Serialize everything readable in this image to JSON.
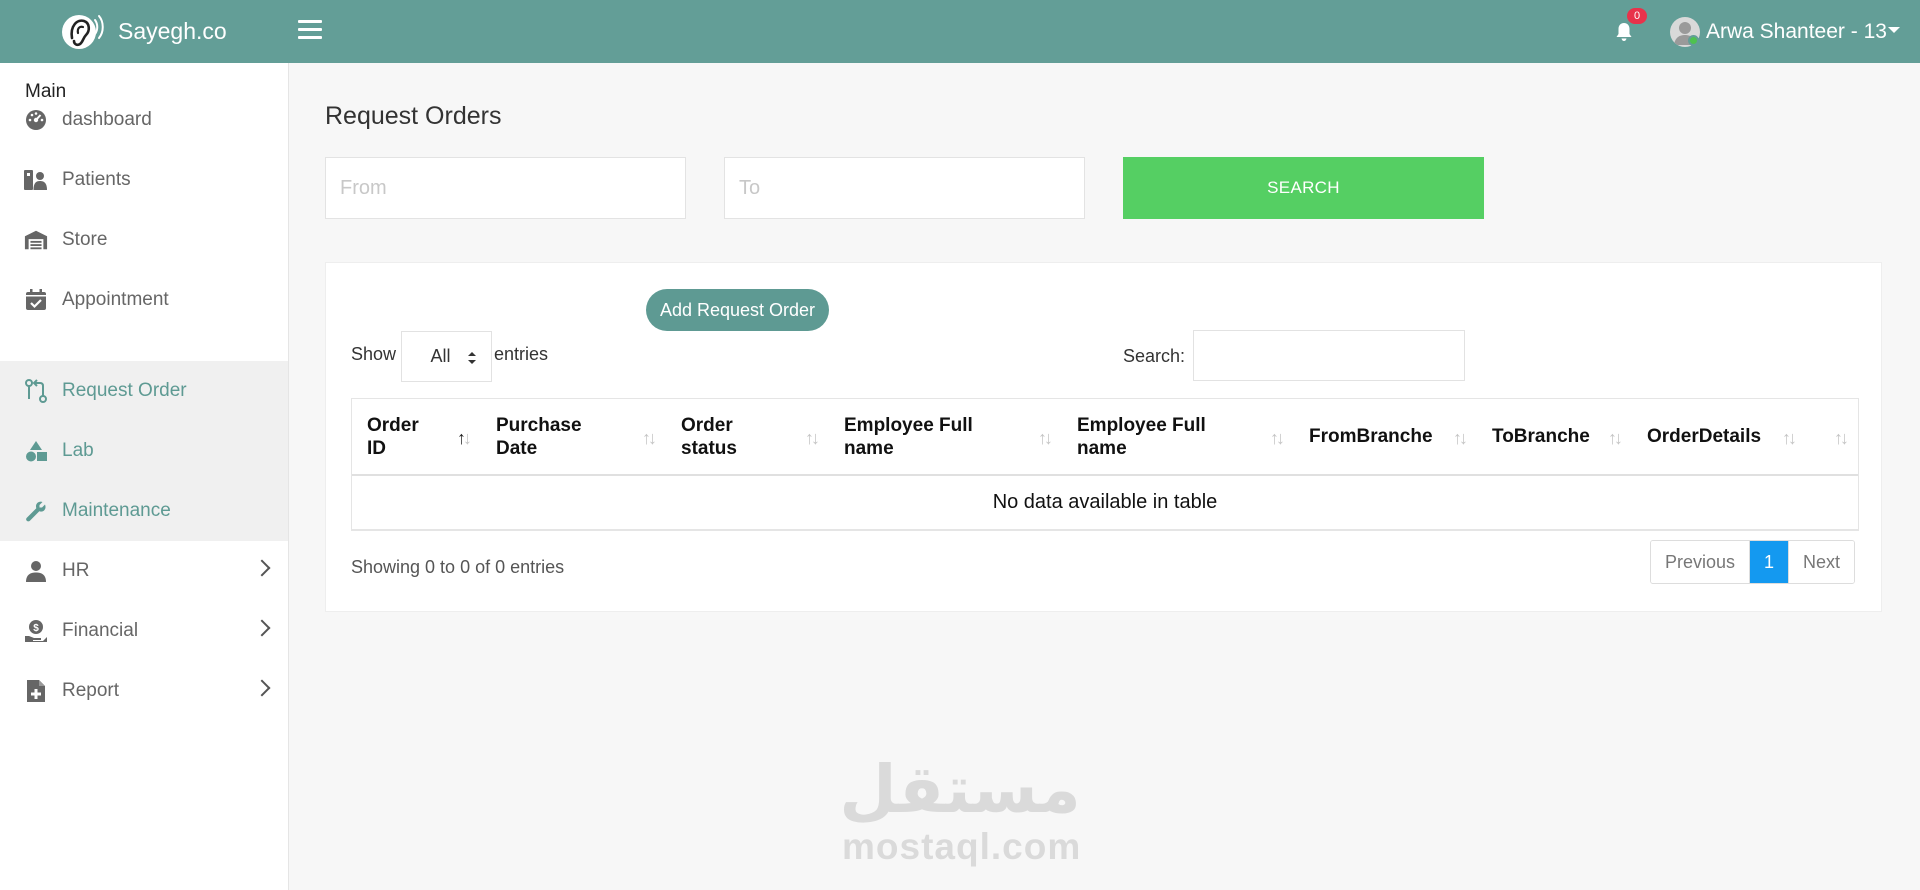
{
  "header": {
    "brand": "Sayegh.co",
    "notification_count": "0",
    "user_name": "Arwa Shanteer - 13",
    "bar_color": "#639e97"
  },
  "sidebar": {
    "heading": "Main",
    "items": [
      {
        "label": "dashboard",
        "icon": "dashboard-icon",
        "active": false,
        "has_submenu": false
      },
      {
        "label": "Patients",
        "icon": "patients-icon",
        "active": false,
        "has_submenu": false
      },
      {
        "label": "Store",
        "icon": "warehouse-icon",
        "active": false,
        "has_submenu": false
      },
      {
        "label": "Appointment",
        "icon": "calendar-check-icon",
        "active": false,
        "has_submenu": false
      },
      {
        "label": "Request Order",
        "icon": "route-icon",
        "active": true,
        "has_submenu": false
      },
      {
        "label": "Lab",
        "icon": "shapes-icon",
        "active": true,
        "has_submenu": false
      },
      {
        "label": "Maintenance",
        "icon": "wrench-icon",
        "active": true,
        "has_submenu": false
      },
      {
        "label": "HR",
        "icon": "user-icon",
        "active": false,
        "has_submenu": true
      },
      {
        "label": "Financial",
        "icon": "hand-coin-icon",
        "active": false,
        "has_submenu": true
      },
      {
        "label": "Report",
        "icon": "file-medical-icon",
        "active": false,
        "has_submenu": true
      }
    ]
  },
  "main": {
    "title": "Request Orders",
    "filters": {
      "from_placeholder": "From",
      "to_placeholder": "To",
      "search_button": "SEARCH"
    },
    "table_controls": {
      "add_button": "Add Request Order",
      "show_label": "Show",
      "length_value": "All",
      "entries_label": "entries",
      "search_label": "Search:"
    },
    "table": {
      "columns": [
        {
          "line1": "Order",
          "line2": "ID"
        },
        {
          "line1": "Purchase",
          "line2": "Date"
        },
        {
          "line1": "Order",
          "line2": "status"
        },
        {
          "line1": "Employee Full",
          "line2": "name"
        },
        {
          "line1": "Employee Full",
          "line2": "name"
        },
        {
          "line1": "",
          "line2": "FromBranche"
        },
        {
          "line1": "",
          "line2": "ToBranche"
        },
        {
          "line1": "",
          "line2": "OrderDetails"
        },
        {
          "line1": "",
          "line2": ""
        }
      ],
      "empty_message": "No data available in table"
    },
    "footer": {
      "info": "Showing 0 to 0 of 0 entries",
      "prev": "Previous",
      "current_page": "1",
      "next": "Next"
    }
  },
  "watermark": {
    "arabic": "مستقل",
    "latin": "mostaql.com"
  },
  "colors": {
    "accent": "#5e9a93",
    "search_button": "#55cf63",
    "pagination_active": "#1499f0",
    "badge": "#e8324b"
  }
}
